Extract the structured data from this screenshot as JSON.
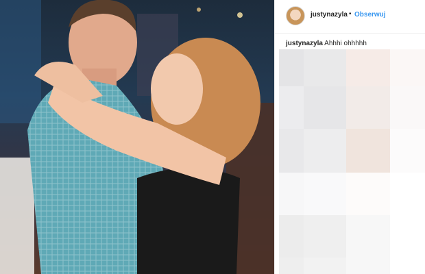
{
  "header": {
    "username": "justynazyla",
    "separator": "•",
    "follow_label": "Obserwuj"
  },
  "caption": {
    "username": "justynazyla",
    "text": "Ahhhi ohhhhh"
  },
  "photo": {
    "description_icon": "dancing-couple-photo"
  }
}
